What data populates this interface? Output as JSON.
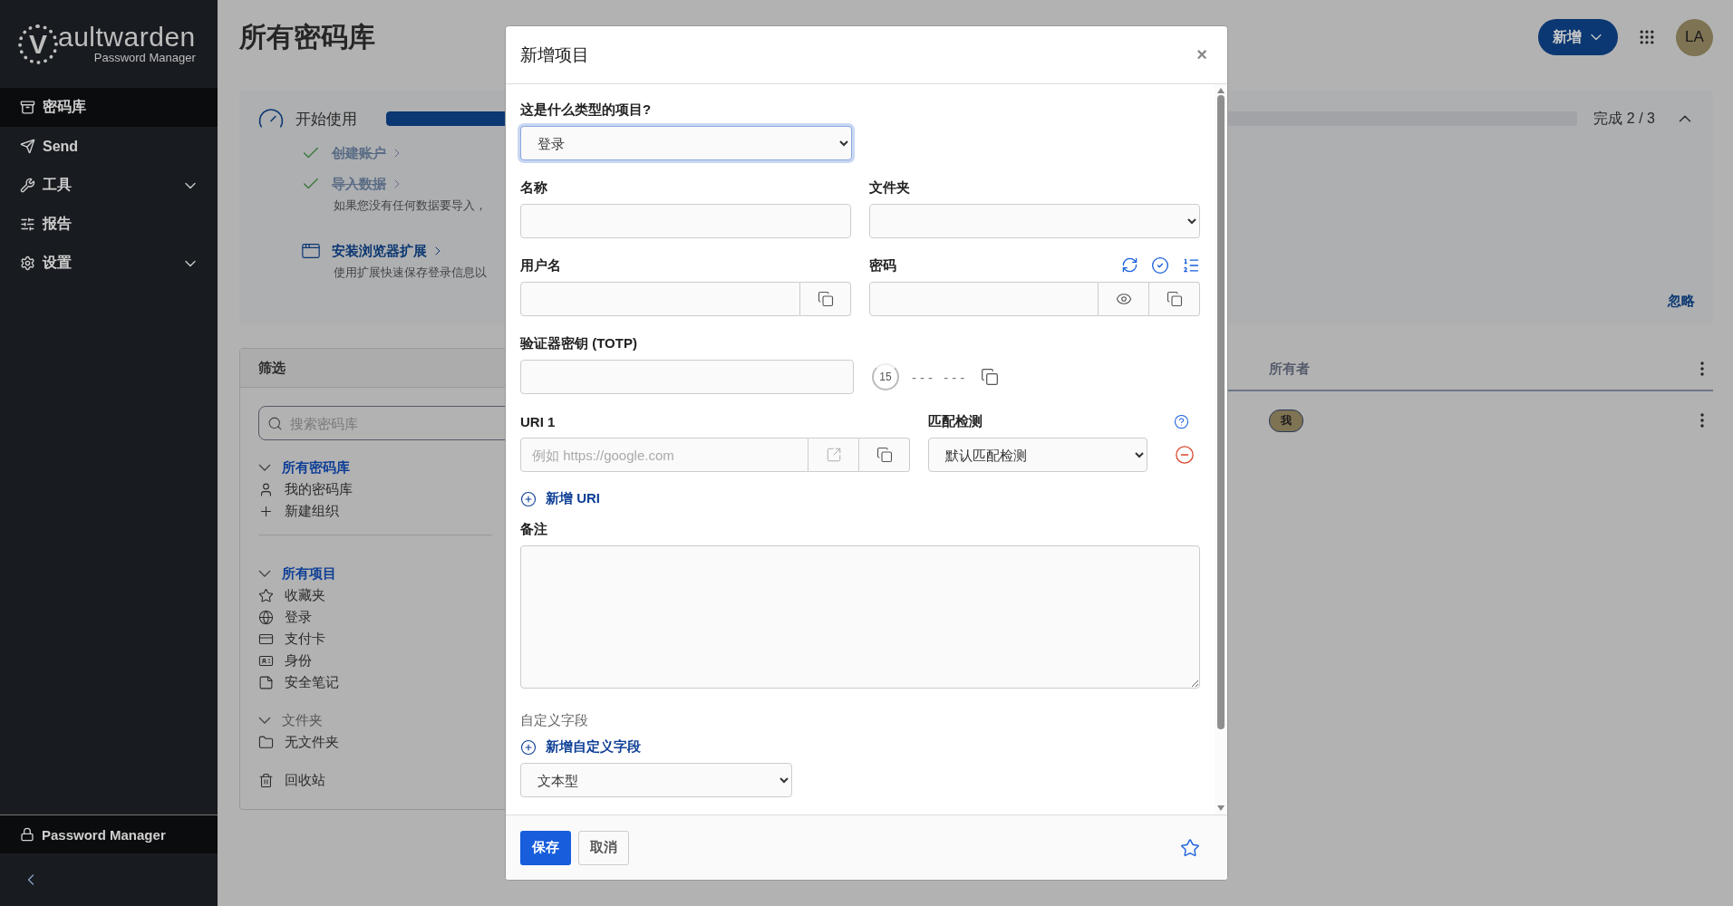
{
  "sidebar": {
    "logo": {
      "initial": "V",
      "word": "aultwarden",
      "tagline": "Password Manager"
    },
    "nav": [
      {
        "label": "密码库",
        "selected": true,
        "expandable": false
      },
      {
        "label": "Send",
        "selected": false,
        "expandable": false
      },
      {
        "label": "工具",
        "selected": false,
        "expandable": true
      },
      {
        "label": "报告",
        "selected": false,
        "expandable": false
      },
      {
        "label": "设置",
        "selected": false,
        "expandable": true
      }
    ],
    "product_switcher": {
      "label": "Password Manager"
    }
  },
  "header": {
    "title": "所有密码库",
    "new_button": "新增",
    "avatar": "LA"
  },
  "getting_started": {
    "title": "开始使用",
    "level": 0.667,
    "progress_text": "完成 2 / 3",
    "dismiss": "忽略",
    "steps": [
      {
        "label": "创建账户",
        "done": true
      },
      {
        "label": "导入数据",
        "done": true,
        "note": "如果您没有任何数据要导入，"
      },
      {
        "label": "安装浏览器扩展",
        "done": false,
        "note": "使用扩展快速保存登录信息以"
      }
    ]
  },
  "filter": {
    "title": "筛选",
    "search_placeholder": "搜索密码库",
    "sections": [
      {
        "heading": "所有密码库",
        "selected": true,
        "items": [
          {
            "label": "我的密码库"
          },
          {
            "label": "新建组织"
          }
        ]
      },
      {
        "heading": "所有项目",
        "selected": true,
        "items": [
          {
            "label": "收藏夹"
          },
          {
            "label": "登录"
          },
          {
            "label": "支付卡"
          },
          {
            "label": "身份"
          },
          {
            "label": "安全笔记"
          }
        ]
      },
      {
        "heading": "文件夹",
        "selected": false,
        "items": [
          {
            "label": "无文件夹"
          }
        ]
      },
      {
        "items": [
          {
            "label": "回收站"
          }
        ]
      }
    ]
  },
  "table": {
    "columns": [
      "所有者"
    ],
    "rows": [
      {
        "owner": "我"
      }
    ]
  },
  "dialog": {
    "title": "新增项目",
    "close": "×",
    "type_label": "这是什么类型的项目?",
    "type_value": "登录",
    "name_label": "名称",
    "folder_label": "文件夹",
    "username_label": "用户名",
    "password_label": "密码",
    "totp_label": "验证器密钥 (TOTP)",
    "totp_seconds": "15",
    "totp_code": "--- ---",
    "uri_label": "URI 1",
    "uri_placeholder": "例如 https://google.com",
    "match_label": "匹配检测",
    "match_value": "默认匹配检测",
    "add_uri": "新增 URI",
    "notes_label": "备注",
    "custom_fields_label": "自定义字段",
    "add_custom_field": "新增自定义字段",
    "field_type": "文本型",
    "save": "保存",
    "cancel": "取消",
    "favorite": false
  }
}
